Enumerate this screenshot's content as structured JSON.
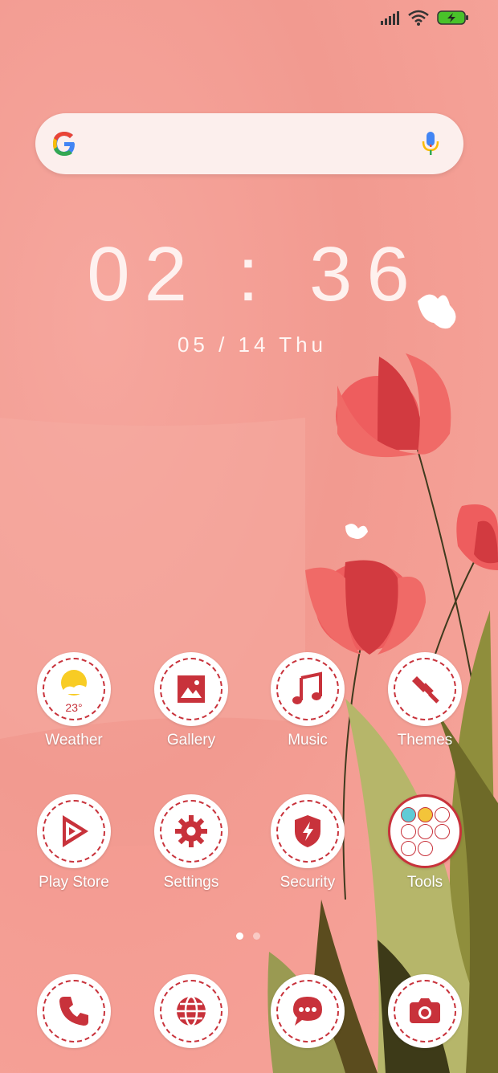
{
  "status": {
    "signal": "signal-icon",
    "wifi": "wifi-icon",
    "battery": "battery-charging-icon"
  },
  "search": {
    "logo": "google-logo-icon",
    "mic": "mic-icon"
  },
  "clock": {
    "time": "02 : 36",
    "date": "05 / 14   Thu"
  },
  "weather": {
    "temp": "23°"
  },
  "apps_row1": [
    {
      "label": "Weather",
      "icon": "weather-icon"
    },
    {
      "label": "Gallery",
      "icon": "gallery-icon"
    },
    {
      "label": "Music",
      "icon": "music-icon"
    },
    {
      "label": "Themes",
      "icon": "themes-icon"
    }
  ],
  "apps_row2": [
    {
      "label": "Play Store",
      "icon": "play-store-icon"
    },
    {
      "label": "Settings",
      "icon": "settings-icon"
    },
    {
      "label": "Security",
      "icon": "security-icon"
    },
    {
      "label": "Tools",
      "icon": "folder-icon"
    }
  ],
  "dock": [
    {
      "icon": "phone-icon"
    },
    {
      "icon": "browser-icon"
    },
    {
      "icon": "messages-icon"
    },
    {
      "icon": "camera-icon"
    }
  ],
  "page_indicator": {
    "pages": 2,
    "current": 1
  },
  "colors": {
    "accent": "#c8323b",
    "wallpaper": "#f4a097"
  }
}
